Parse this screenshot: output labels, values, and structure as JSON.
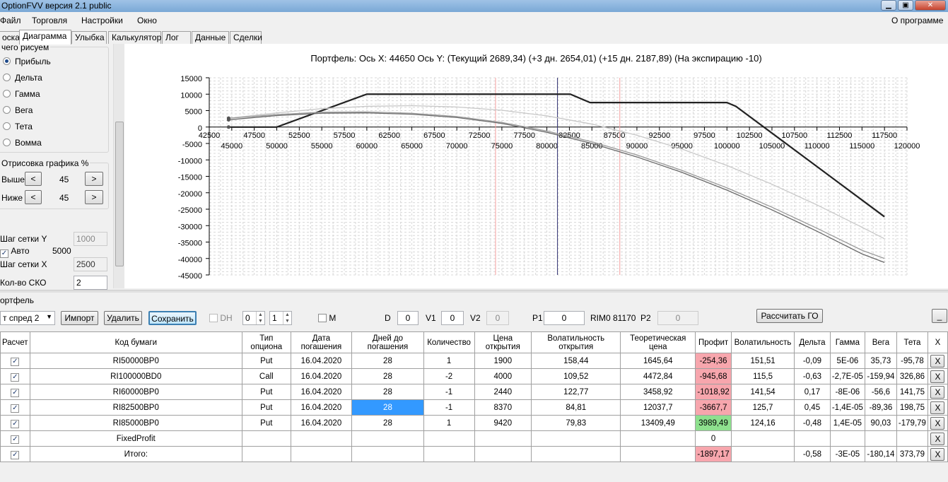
{
  "window": {
    "title": "OptionFVV версия 2.1 public"
  },
  "menu": {
    "file": "Файл",
    "trade": "Торговля",
    "settings": "Настройки",
    "window": "Окно",
    "about": "О программе"
  },
  "tabs": [
    "оска",
    "Диаграмма",
    "Улыбка",
    "Калькулятор",
    "Лог",
    "Данные",
    "Сделки"
  ],
  "left": {
    "what_group": "чего рисуем",
    "radios": [
      "Прибыль",
      "Дельта",
      "Гамма",
      "Вега",
      "Тета",
      "Вомма"
    ],
    "selected": "Прибыль",
    "draw_group": "Отрисовка графика %",
    "above_label": "Выше",
    "above_value": "45",
    "below_label": "Ниже",
    "below_value": "45",
    "prev": "<",
    "next": ">",
    "grid_y_label": "Шаг сетки Y",
    "grid_y_value": "1000",
    "auto_label": "Авто",
    "auto_value": "5000",
    "grid_x_label": "Шаг сетки X",
    "grid_x_value": "2500",
    "sko_label": "Кол-во СКО",
    "sko_value": "2"
  },
  "chart_header": "Портфель:  Ось X:  44650  Ось Y:   (Текущий 2689,34)   (+3 дн. 2654,01)   (+15 дн. 2187,89)   (На экспирацию -10)",
  "chart_data": {
    "type": "line",
    "xlim": [
      42500,
      120000
    ],
    "ylim": [
      -45000,
      15000
    ],
    "x_ticks_top": [
      "42500",
      "47500",
      "52500",
      "57500",
      "62500",
      "67500",
      "72500",
      "77500",
      "82500",
      "87500",
      "92500",
      "97500",
      "102500",
      "107500",
      "112500",
      "117500"
    ],
    "x_ticks_bottom": [
      "45000",
      "50000",
      "55000",
      "60000",
      "65000",
      "70000",
      "75000",
      "80000",
      "85000",
      "90000",
      "95000",
      "100000",
      "105000",
      "110000",
      "115000",
      "120000"
    ],
    "y_ticks": [
      "15000",
      "10000",
      "5000",
      "0",
      "-5000",
      "-10000",
      "-15000",
      "-20000",
      "-25000",
      "-30000",
      "-35000",
      "-40000",
      "-45000"
    ],
    "grid": true,
    "vlines": [
      {
        "x": 74300,
        "color": "#f4a0a0"
      },
      {
        "x": 81170,
        "color": "#3a3a7a"
      },
      {
        "x": 88100,
        "color": "#f4a0a0"
      }
    ],
    "series": [
      {
        "color": "#222222",
        "x": [
          44650,
          50000,
          60000,
          82600,
          84800,
          100000,
          101000,
          117500
        ],
        "y": [
          -10,
          -10,
          10000,
          10000,
          7450,
          7450,
          6300,
          -27300
        ]
      },
      {
        "color": "#c8c8c8",
        "x": [
          44650,
          50000,
          55000,
          60000,
          65000,
          70000,
          75000,
          80000,
          85000,
          90000,
          95000,
          100000,
          105000,
          110000,
          115000,
          117500
        ],
        "y": [
          2689,
          4300,
          5600,
          6300,
          6500,
          6100,
          5100,
          3400,
          900,
          -2500,
          -6700,
          -11700,
          -17400,
          -23700,
          -30500,
          -34000
        ]
      },
      {
        "color": "#9a9a9a",
        "x": [
          44650,
          50000,
          55000,
          60000,
          65000,
          70000,
          75000,
          80000,
          85000,
          90000,
          95000,
          100000,
          105000,
          110000,
          115000,
          117500
        ],
        "y": [
          2654,
          3800,
          4500,
          4600,
          4200,
          3200,
          1400,
          -1200,
          -4500,
          -8500,
          -13200,
          -18500,
          -24400,
          -30800,
          -37500,
          -40000
        ]
      },
      {
        "color": "#6a6a6a",
        "x": [
          44650,
          50000,
          55000,
          60000,
          65000,
          70000,
          75000,
          80000,
          85000,
          90000,
          95000,
          100000,
          105000,
          110000,
          115000,
          117500
        ],
        "y": [
          2188,
          3500,
          4200,
          4300,
          3900,
          2900,
          1100,
          -1600,
          -5000,
          -9100,
          -13800,
          -19200,
          -25200,
          -31700,
          -38600,
          -41200
        ]
      }
    ]
  },
  "portfolio": {
    "label": "ортфель",
    "combo": "т спред 2",
    "import": "Импорт",
    "delete": "Удалить",
    "save": "Сохранить",
    "dh_label": "DH",
    "spin1": "0",
    "spin2": "1",
    "m_label": "M",
    "d_label": "D",
    "d_value": "0",
    "v1_label": "V1",
    "v1_value": "0",
    "v2_label": "V2",
    "v2_value": "0",
    "p1_label": "P1",
    "p1_value": "0",
    "rim_label": "RIM0 81170",
    "p2_label": "P2",
    "p2_value": "0",
    "calc_go": "Рассчитать ГО",
    "minimize": "_"
  },
  "table": {
    "headers": [
      "Расчет",
      "Код бумаги",
      "Тип\nопциона",
      "Дата\nпогашения",
      "Дней до\nпогашения",
      "Количество",
      "Цена\nоткрытия",
      "Волатильность\nоткрытия",
      "Теоретическая\nцена",
      "Профит",
      "Волатильность",
      "Дельта",
      "Гамма",
      "Вега",
      "Тета",
      "X"
    ],
    "rows": [
      [
        "RI50000BP0",
        "Put",
        "16.04.2020",
        "28",
        "1",
        "1900",
        "158,44",
        "1645,64",
        "-254,36",
        "151,51",
        "-0,09",
        "5E-06",
        "35,73",
        "-95,78"
      ],
      [
        "RI100000BD0",
        "Call",
        "16.04.2020",
        "28",
        "-2",
        "4000",
        "109,52",
        "4472,84",
        "-945,68",
        "115,5",
        "-0,63",
        "-2,7E-05",
        "-159,94",
        "326,86"
      ],
      [
        "RI60000BP0",
        "Put",
        "16.04.2020",
        "28",
        "-1",
        "2440",
        "122,77",
        "3458,92",
        "-1018,92",
        "141,54",
        "0,17",
        "-8E-06",
        "-56,6",
        "141,75"
      ],
      [
        "RI82500BP0",
        "Put",
        "16.04.2020",
        "28",
        "-1",
        "8370",
        "84,81",
        "12037,7",
        "-3667,7",
        "125,7",
        "0,45",
        "-1,4E-05",
        "-89,36",
        "198,75"
      ],
      [
        "RI85000BP0",
        "Put",
        "16.04.2020",
        "28",
        "1",
        "9420",
        "79,83",
        "13409,49",
        "3989,49",
        "124,16",
        "-0,48",
        "1,4E-05",
        "90,03",
        "-179,79"
      ]
    ],
    "fixed_label": "FixedProfit",
    "fixed_value": "0",
    "total_label": "Итого:",
    "total_profit": "-1897,17",
    "total_delta": "-0,58",
    "total_gamma": "-3E-05",
    "total_vega": "-180,14",
    "total_theta": "373,79",
    "x": "X"
  }
}
